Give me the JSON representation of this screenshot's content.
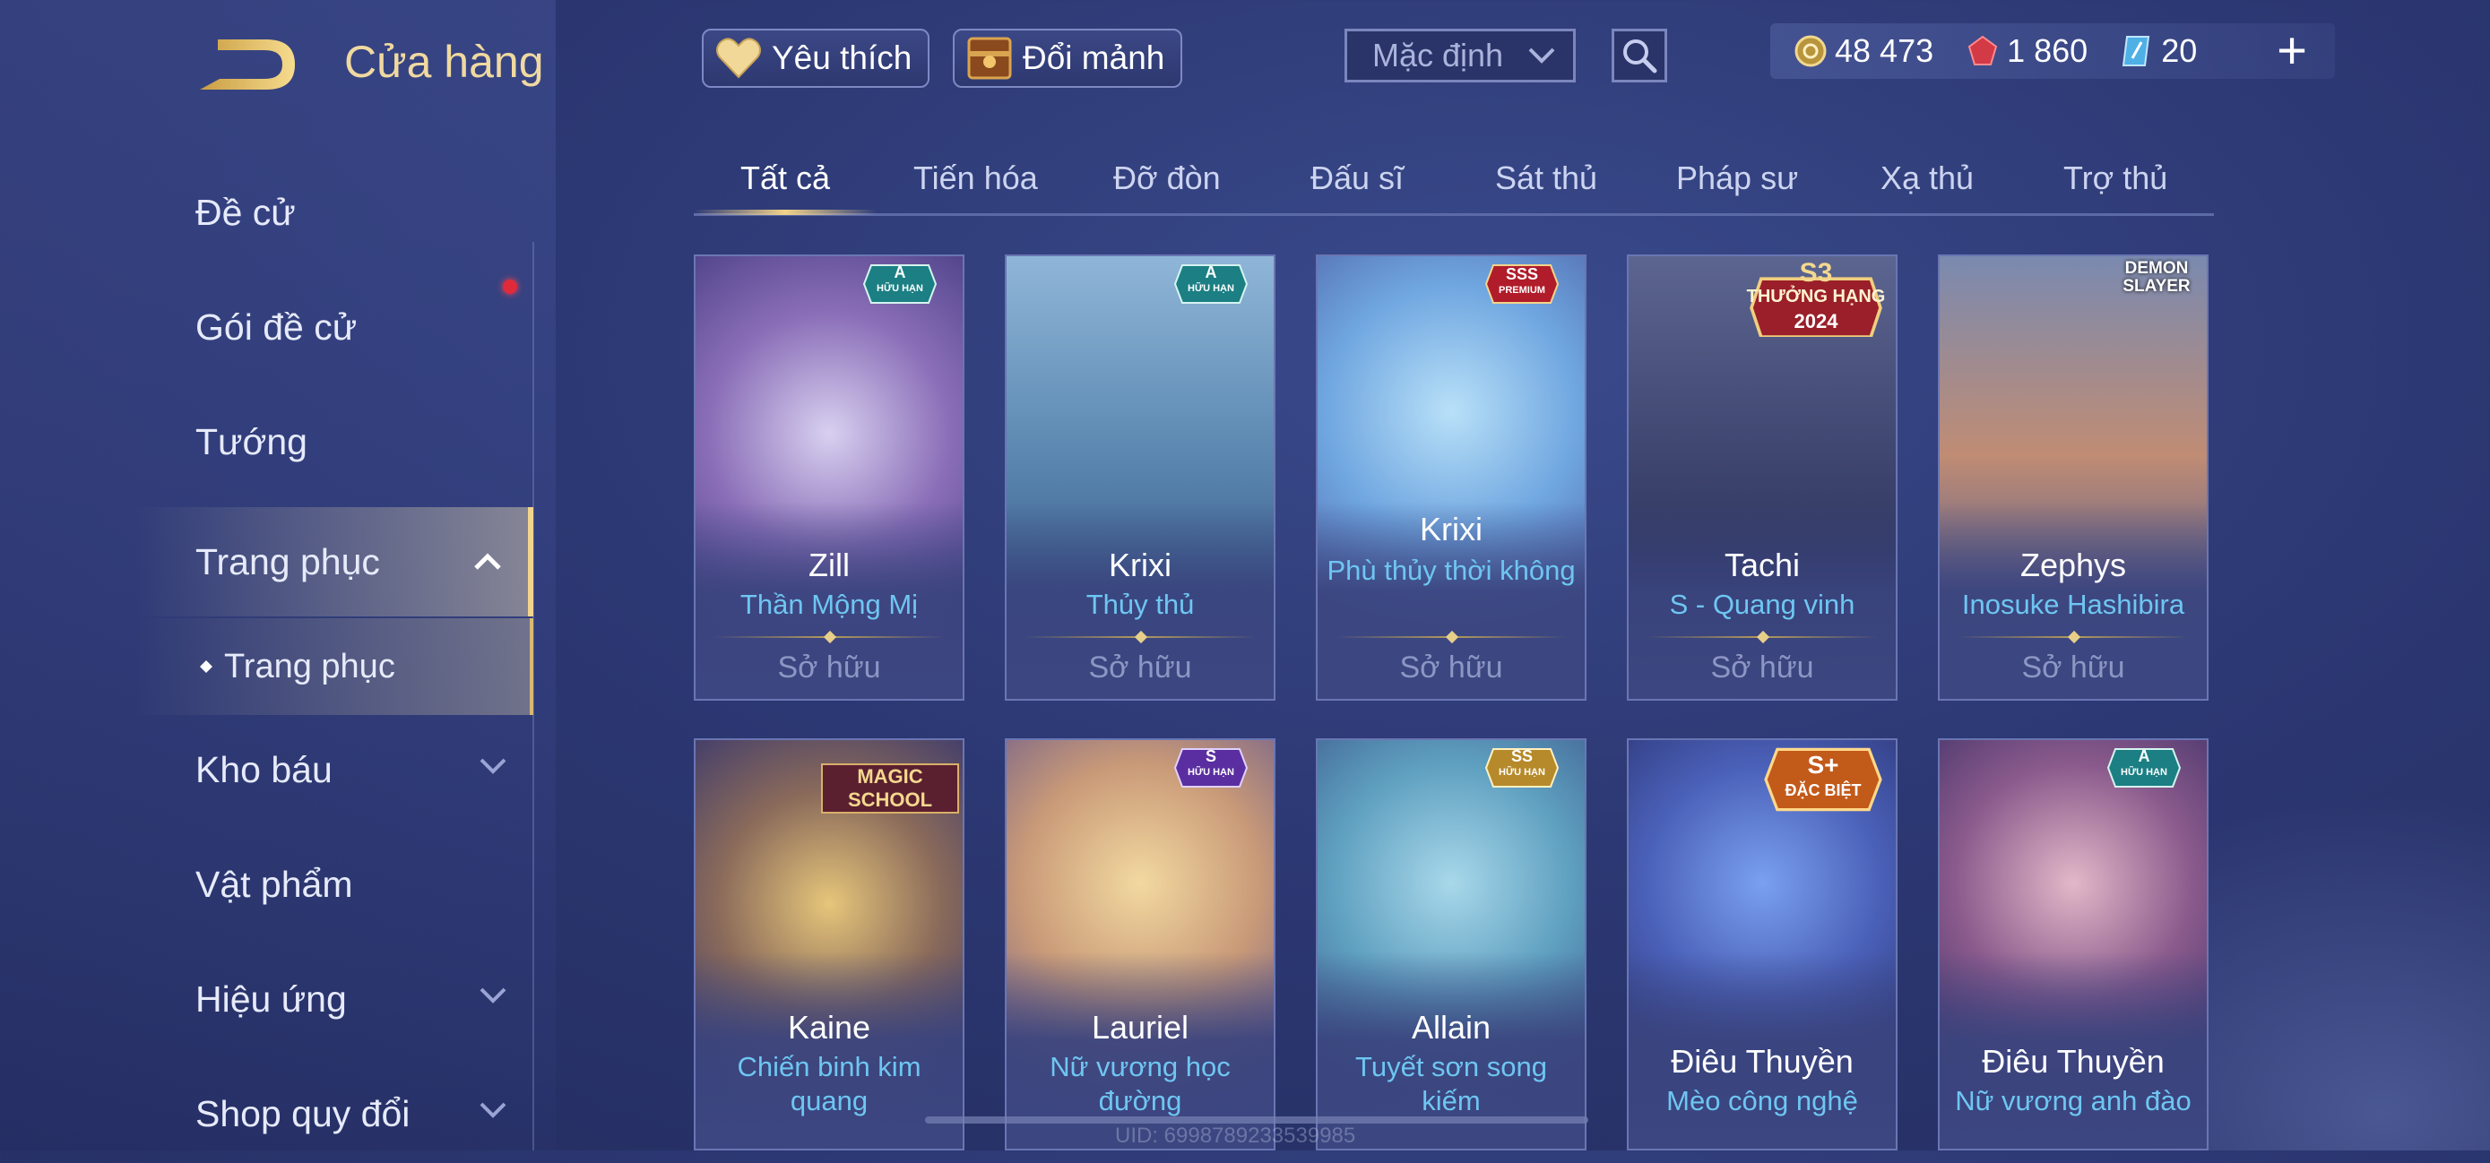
{
  "header": {
    "title": "Cửa hàng",
    "favorite_label": "Yêu thích",
    "exchange_label": "Đổi mảnh",
    "sort_selected": "Mặc định"
  },
  "currency": {
    "gold": "48 473",
    "gems": "1 860",
    "vouchers": "20"
  },
  "sidebar": {
    "items": [
      {
        "label": "Đề cử"
      },
      {
        "label": "Gói đề cử"
      },
      {
        "label": "Tướng"
      },
      {
        "label": "Trang phục"
      },
      {
        "label": "Trang phục"
      },
      {
        "label": "Kho báu"
      },
      {
        "label": "Vật phẩm"
      },
      {
        "label": "Hiệu ứng"
      },
      {
        "label": "Shop quy đổi"
      }
    ]
  },
  "tabs": [
    "Tất cả",
    "Tiến hóa",
    "Đỡ đòn",
    "Đấu sĩ",
    "Sát thủ",
    "Pháp sư",
    "Xạ thủ",
    "Trợ thủ"
  ],
  "cards": [
    {
      "hero": "Zill",
      "skin": "Thần Mộng Mị",
      "status": "Sở hữu",
      "badge": "A",
      "badge_sub": "HỮU HẠN"
    },
    {
      "hero": "Krixi",
      "skin": "Thủy thủ",
      "status": "Sở hữu",
      "badge": "A",
      "badge_sub": "HỮU HẠN"
    },
    {
      "hero": "Krixi",
      "skin": "Phù thủy thời không",
      "status": "Sở hữu",
      "badge": "SSS",
      "badge_sub": "PREMIUM"
    },
    {
      "hero": "Tachi",
      "skin": "S - Quang vinh",
      "status": "Sở hữu",
      "badge": "S3",
      "badge_sub": "THƯỞNG HẠNG",
      "badge_year": "2024"
    },
    {
      "hero": "Zephys",
      "skin": "Inosuke Hashibira",
      "status": "Sở hữu",
      "badge": "DEMON SLAYER",
      "badge_sub": ""
    },
    {
      "hero": "Kaine",
      "skin": "Chiến binh kim quang",
      "badge": "MAGIC SCHOOL",
      "badge_sub": ""
    },
    {
      "hero": "Lauriel",
      "skin": "Nữ vương học đường",
      "badge": "S",
      "badge_sub": "HỮU HẠN"
    },
    {
      "hero": "Allain",
      "skin": "Tuyết sơn song kiếm",
      "badge": "SS",
      "badge_sub": "HỮU HẠN"
    },
    {
      "hero": "Điêu Thuyền",
      "skin": "Mèo công nghệ",
      "badge": "S+",
      "badge_sub": "ĐẶC BIỆT"
    },
    {
      "hero": "Điêu Thuyền",
      "skin": "Nữ vương anh đào",
      "badge": "A",
      "badge_sub": "HỮU HẠN"
    }
  ],
  "footer": {
    "uid": "UID: 6998789233539985"
  },
  "colors": {
    "accent_gold": "#f0d28a",
    "skin_blue": "#6ec6f2",
    "card_border": "#6a76b3",
    "background": "#2c3873"
  }
}
